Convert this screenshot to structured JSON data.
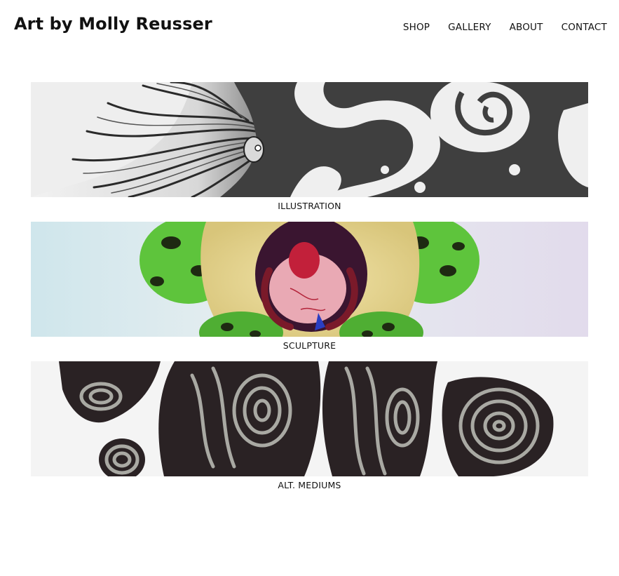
{
  "header": {
    "site_title": "Art by Molly Reusser",
    "nav": [
      {
        "label": "SHOP"
      },
      {
        "label": "GALLERY"
      },
      {
        "label": "ABOUT"
      },
      {
        "label": "CONTACT"
      }
    ]
  },
  "gallery": {
    "items": [
      {
        "label": "ILLUSTRATION",
        "image": "illustration-banner"
      },
      {
        "label": "SCULPTURE",
        "image": "sculpture-banner"
      },
      {
        "label": "ALT. MEDIUMS",
        "image": "alt-mediums-banner"
      }
    ]
  },
  "colors": {
    "background": "#ffffff",
    "text": "#111111"
  }
}
